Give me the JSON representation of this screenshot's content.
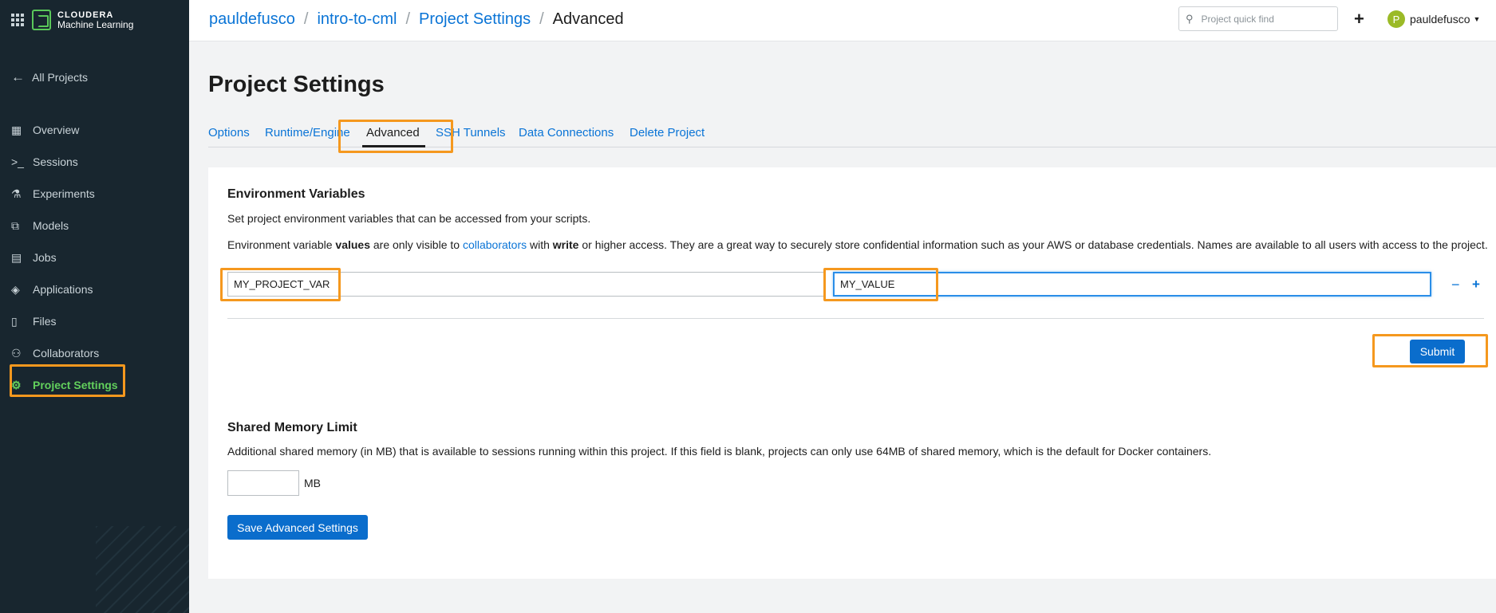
{
  "brand": {
    "line1": "CLOUDERA",
    "line2": "Machine Learning"
  },
  "sidebar": {
    "back_label": "All Projects",
    "items": [
      {
        "label": "Overview",
        "icon": "grid-icon"
      },
      {
        "label": "Sessions",
        "icon": "terminal-icon"
      },
      {
        "label": "Experiments",
        "icon": "flask-icon"
      },
      {
        "label": "Models",
        "icon": "model-icon"
      },
      {
        "label": "Jobs",
        "icon": "jobs-icon"
      },
      {
        "label": "Applications",
        "icon": "layers-icon"
      },
      {
        "label": "Files",
        "icon": "file-icon"
      },
      {
        "label": "Collaborators",
        "icon": "users-icon"
      },
      {
        "label": "Project Settings",
        "icon": "gear-icon",
        "active": true
      }
    ]
  },
  "header": {
    "breadcrumbs": [
      "pauldefusco",
      "intro-to-cml",
      "Project Settings",
      "Advanced"
    ],
    "search_placeholder": "Project quick find",
    "username": "pauldefusco",
    "avatar_initial": "P"
  },
  "page": {
    "title": "Project Settings",
    "tabs": [
      "Options",
      "Runtime/Engine",
      "Advanced",
      "SSH Tunnels",
      "Data Connections",
      "Delete Project"
    ],
    "active_tab": "Advanced"
  },
  "env_vars": {
    "title": "Environment Variables",
    "desc": "Set project environment variables that can be accessed from your scripts.",
    "note_1": "Environment variable ",
    "note_values": "values",
    "note_2": " are only visible to ",
    "note_collaborators": "collaborators",
    "note_3": " with ",
    "note_write": "write",
    "note_4": " or higher access. They are a great way to securely store confidential information such as your AWS or database credentials. Names are available to all users with access to the project.",
    "name_value": "MY_PROJECT_VAR",
    "value_value": "MY_VALUE",
    "remove_label": "−",
    "add_label": "+",
    "submit_label": "Submit"
  },
  "shared_memory": {
    "title": "Shared Memory Limit",
    "desc": "Additional shared memory (in MB) that is available to sessions running within this project. If this field is blank, projects can only use 64MB of shared memory, which is the default for Docker containers.",
    "value": "",
    "unit": "MB"
  },
  "save_label": "Save Advanced Settings",
  "colors": {
    "sidebar_bg": "#18262f",
    "accent_green": "#62d05c",
    "link_blue": "#0a74d6",
    "button_blue": "#0a6dcc",
    "highlight_orange": "#f5981e"
  }
}
